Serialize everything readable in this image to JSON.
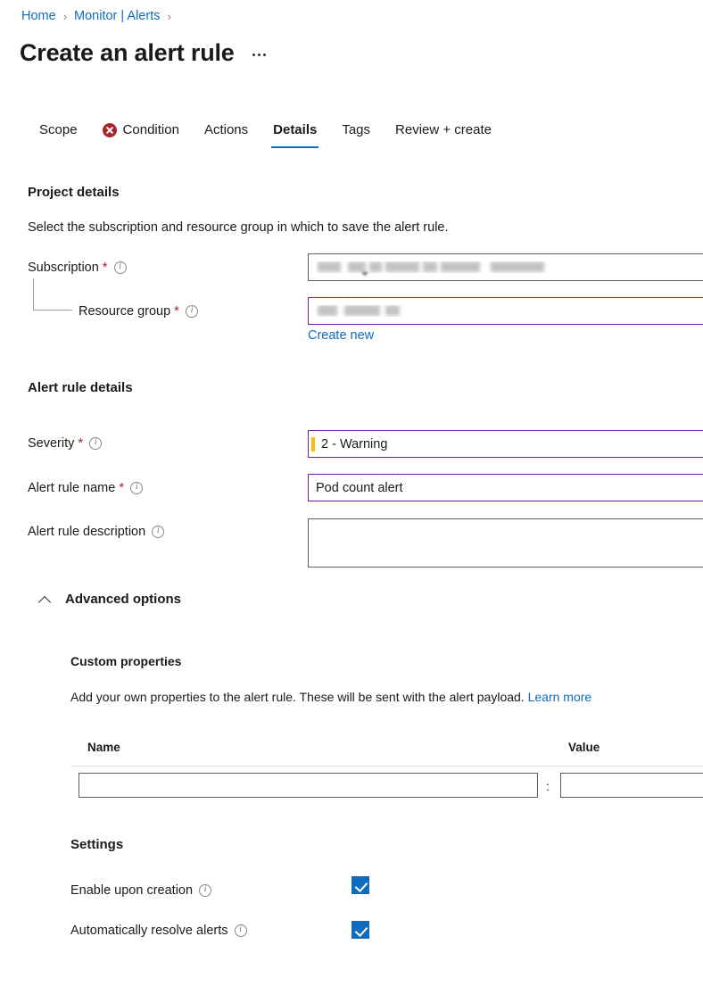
{
  "breadcrumb": {
    "items": [
      {
        "label": "Home"
      },
      {
        "label": "Monitor | Alerts"
      }
    ],
    "separator": "›"
  },
  "header": {
    "title": "Create an alert rule",
    "more_actions_label": "…"
  },
  "tabs": [
    {
      "label": "Scope",
      "active": false,
      "status": ""
    },
    {
      "label": "Condition",
      "active": false,
      "status": "error"
    },
    {
      "label": "Actions",
      "active": false,
      "status": ""
    },
    {
      "label": "Details",
      "active": true,
      "status": ""
    },
    {
      "label": "Tags",
      "active": false,
      "status": ""
    },
    {
      "label": "Review + create",
      "active": false,
      "status": ""
    }
  ],
  "project_details": {
    "heading": "Project details",
    "description": "Select the subscription and resource group in which to save the alert rule.",
    "subscription": {
      "label": "Subscription",
      "required": "*",
      "value": "",
      "redacted": true
    },
    "resource_group": {
      "label": "Resource group",
      "required": "*",
      "value": "",
      "redacted": true,
      "create_new_link": "Create new"
    }
  },
  "alert_rule_details": {
    "heading": "Alert rule details",
    "severity": {
      "label": "Severity",
      "required": "*",
      "value": "2 - Warning",
      "indicator_color": "#ffb900"
    },
    "alert_rule_name": {
      "label": "Alert rule name",
      "required": "*",
      "value": "Pod count alert"
    },
    "alert_rule_description": {
      "label": "Alert rule description",
      "required": "",
      "value": ""
    }
  },
  "advanced_options": {
    "label": "Advanced options",
    "expanded": true,
    "chevron": "chevron-up-icon",
    "custom_properties": {
      "heading": "Custom properties",
      "description": "Add your own properties to the alert rule. These will be sent with the alert payload.",
      "learn_more": "Learn more",
      "columns": [
        "Name",
        "Value"
      ],
      "separator": ":",
      "rows": [
        {
          "name": "",
          "value": ""
        }
      ]
    },
    "settings": {
      "heading": "Settings",
      "options": [
        {
          "label": "Enable upon creation",
          "checked": true
        },
        {
          "label": "Automatically resolve alerts",
          "checked": true
        }
      ]
    }
  },
  "colors": {
    "accent": "#0f6cbd",
    "link": "#0f6cbd",
    "error": "#a4262c",
    "required": "#a4262c",
    "focus_border": "#7719aa",
    "severity_warning": "#ffb900",
    "checkbox": "#0f6cbd"
  }
}
